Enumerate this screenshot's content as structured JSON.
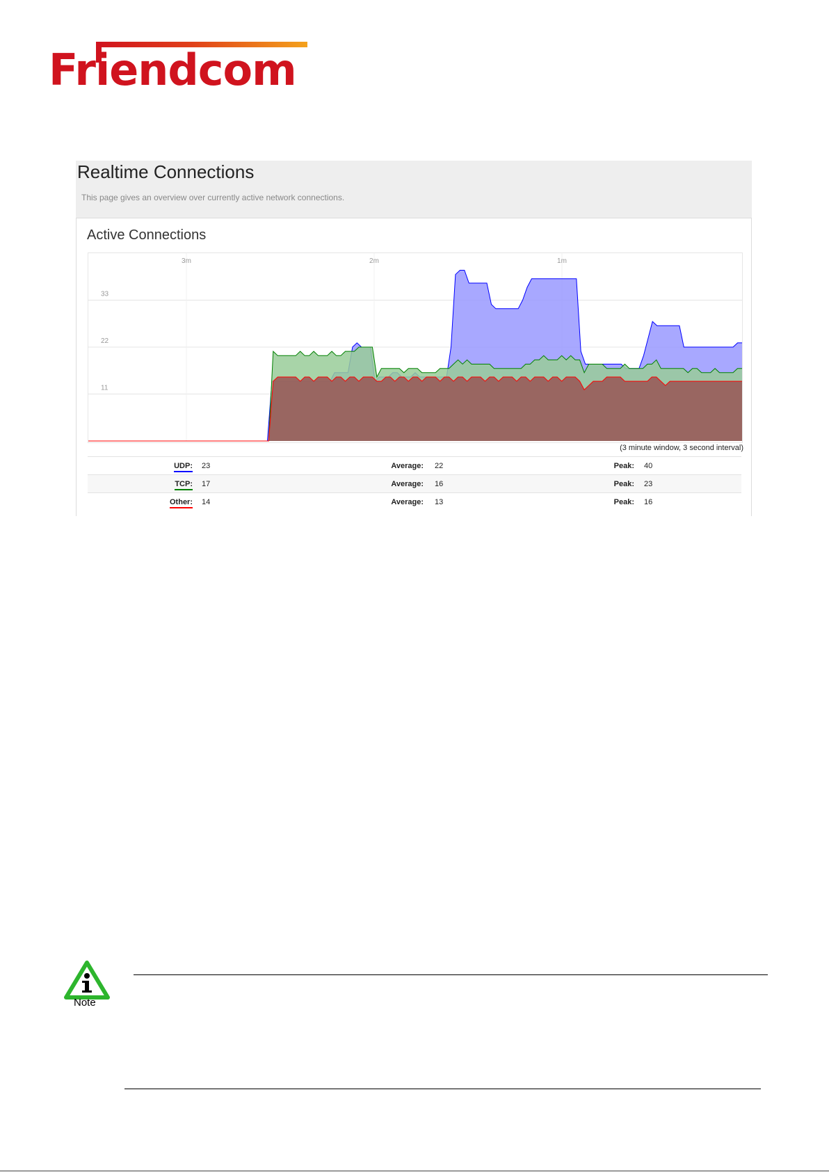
{
  "logo": {
    "text": "Friendcom"
  },
  "page": {
    "title": "Realtime Connections",
    "description": "This page gives an overview over currently active network connections."
  },
  "panel": {
    "title": "Active Connections",
    "window_note": "(3 minute window, 3 second interval)"
  },
  "chart_data": {
    "type": "area",
    "x_ticks": [
      "3m",
      "2m",
      "1m"
    ],
    "y_ticks": [
      "33",
      "22",
      "11"
    ],
    "ylim": [
      0,
      44
    ],
    "grid": true,
    "series": [
      {
        "name": "UDP",
        "color": "#0000ff",
        "fill": "#9999ff",
        "values": [
          0,
          0,
          0,
          0,
          0,
          0,
          0,
          0,
          0,
          0,
          0,
          0,
          0,
          0,
          0,
          0,
          0,
          0,
          0,
          0,
          0,
          0,
          0,
          0,
          0,
          0,
          0,
          0,
          0,
          0,
          0,
          0,
          0,
          0,
          0,
          0,
          0,
          0,
          0,
          0,
          0,
          14,
          14,
          14,
          14,
          14,
          14,
          14,
          14,
          14,
          14,
          14,
          14,
          14,
          14,
          16,
          16,
          16,
          16,
          22,
          23,
          22,
          22,
          22,
          14,
          15,
          15,
          15,
          16,
          16,
          15,
          15,
          15,
          16,
          15,
          15,
          15,
          15,
          15,
          15,
          15,
          22,
          39,
          40,
          40,
          37,
          37,
          37,
          37,
          37,
          32,
          31,
          31,
          31,
          31,
          31,
          31,
          33,
          36,
          38,
          38,
          38,
          38,
          38,
          38,
          38,
          38,
          38,
          38,
          38,
          21,
          18,
          18,
          18,
          18,
          18,
          18,
          18,
          18,
          18,
          17,
          17,
          17,
          17,
          20,
          24,
          28,
          27,
          27,
          27,
          27,
          27,
          27,
          22,
          22,
          22,
          22,
          22,
          22,
          22,
          22,
          22,
          22,
          22,
          22,
          23,
          23
        ]
      },
      {
        "name": "TCP",
        "color": "#008000",
        "fill": "#99cc99",
        "values": [
          0,
          0,
          0,
          0,
          0,
          0,
          0,
          0,
          0,
          0,
          0,
          0,
          0,
          0,
          0,
          0,
          0,
          0,
          0,
          0,
          0,
          0,
          0,
          0,
          0,
          0,
          0,
          0,
          0,
          0,
          0,
          0,
          0,
          0,
          0,
          0,
          0,
          0,
          0,
          0,
          0,
          21,
          20,
          20,
          20,
          20,
          20,
          21,
          20,
          20,
          21,
          20,
          20,
          20,
          21,
          20,
          20,
          21,
          21,
          21,
          22,
          22,
          22,
          22,
          15,
          17,
          17,
          17,
          17,
          17,
          16,
          17,
          17,
          17,
          16,
          16,
          16,
          16,
          17,
          17,
          17,
          18,
          19,
          18,
          19,
          18,
          18,
          18,
          18,
          18,
          17,
          17,
          17,
          17,
          17,
          17,
          17,
          18,
          18,
          19,
          19,
          20,
          19,
          19,
          19,
          20,
          19,
          20,
          19,
          19,
          16,
          18,
          18,
          18,
          18,
          17,
          17,
          17,
          17,
          18,
          17,
          17,
          17,
          17,
          18,
          18,
          19,
          17,
          17,
          17,
          17,
          17,
          17,
          16,
          17,
          17,
          16,
          16,
          16,
          17,
          16,
          16,
          16,
          16,
          17,
          17
        ]
      },
      {
        "name": "Other",
        "color": "#ff0000",
        "fill": "#995555",
        "values": [
          0,
          0,
          0,
          0,
          0,
          0,
          0,
          0,
          0,
          0,
          0,
          0,
          0,
          0,
          0,
          0,
          0,
          0,
          0,
          0,
          0,
          0,
          0,
          0,
          0,
          0,
          0,
          0,
          0,
          0,
          0,
          0,
          0,
          0,
          0,
          0,
          0,
          0,
          0,
          0,
          0,
          14,
          15,
          15,
          15,
          15,
          15,
          14,
          15,
          15,
          14,
          15,
          15,
          15,
          14,
          15,
          15,
          14,
          15,
          15,
          14,
          15,
          15,
          15,
          14,
          14,
          15,
          15,
          14,
          15,
          15,
          14,
          15,
          15,
          14,
          15,
          15,
          15,
          14,
          15,
          15,
          14,
          15,
          15,
          14,
          15,
          15,
          15,
          14,
          15,
          15,
          14,
          15,
          15,
          15,
          14,
          15,
          15,
          14,
          15,
          15,
          15,
          14,
          15,
          15,
          14,
          15,
          15,
          15,
          14,
          12,
          13,
          14,
          14,
          14,
          15,
          15,
          15,
          15,
          14,
          14,
          14,
          14,
          14,
          14,
          15,
          15,
          14,
          13,
          14,
          14,
          14,
          14,
          14,
          14,
          14,
          14,
          14,
          14,
          14,
          14,
          14,
          14,
          14,
          14,
          14
        ]
      }
    ]
  },
  "stats": [
    {
      "label": "UDP:",
      "current": "23",
      "avg_label": "Average:",
      "avg": "22",
      "peak_label": "Peak:",
      "peak": "40"
    },
    {
      "label": "TCP:",
      "current": "17",
      "avg_label": "Average:",
      "avg": "16",
      "peak_label": "Peak:",
      "peak": "23"
    },
    {
      "label": "Other:",
      "current": "14",
      "avg_label": "Average:",
      "avg": "13",
      "peak_label": "Peak:",
      "peak": "16"
    }
  ],
  "note": {
    "icon": "info-triangle-icon",
    "label": "Note"
  }
}
